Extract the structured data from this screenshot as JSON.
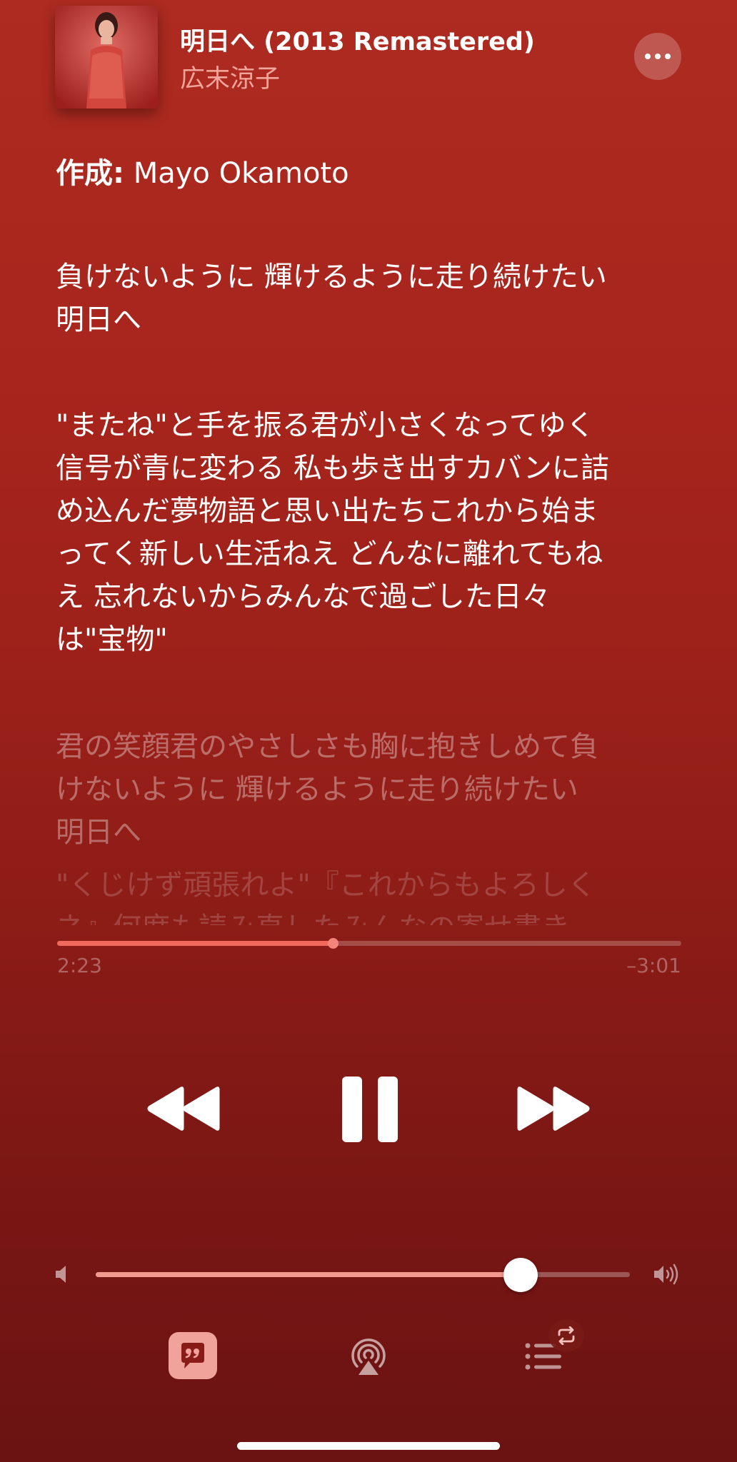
{
  "now_playing": {
    "title": "明日へ (2013 Remastered)",
    "artist": "広末涼子",
    "more_icon": "ellipsis-icon"
  },
  "lyrics": {
    "credit_label": "作成:",
    "credit_value": " Mayo Okamoto",
    "verse_1": [
      "負けないように 輝けるように走り続けたい",
      "明日へ"
    ],
    "verse_2": [
      "\"またね\"と手を振る君が小さくなってゆく",
      "信号が青に変わる 私も歩き出すカバンに詰",
      "め込んだ夢物語と思い出たちこれから始ま",
      "ってく新しい生活ねえ どんなに離れてもね",
      "え 忘れないからみんなで過ごした日々",
      "は\"宝物\""
    ],
    "verse_3": [
      "君の笑顔君のやさしさも胸に抱きしめて負",
      "けないように 輝けるように走り続けたい",
      "明日へ"
    ],
    "verse_4": [
      "\"くじけず頑張れよ\"『これからもよろしく",
      "ネ』何度も読み直したみんなの寄せ書き"
    ]
  },
  "playback": {
    "elapsed": "2:23",
    "remaining": "–3:01",
    "progress": 0.4416
  },
  "transport": {
    "rewind_icon": "rewind-icon",
    "pause_icon": "pause-icon",
    "forward_icon": "fast-forward-icon"
  },
  "volume": {
    "level": 0.795,
    "low_icon": "speaker-low-icon",
    "high_icon": "speaker-high-icon"
  },
  "bottom_bar": {
    "lyrics_icon": "lyrics-quote-icon",
    "airplay_icon": "airplay-icon",
    "queue_icon": "queue-list-icon",
    "repeat_icon": "repeat-icon"
  },
  "colors": {
    "background_top": "#ad2b20",
    "background_bottom": "#6a1312",
    "accent": "#f06a5e",
    "artist_text": "#f2a59b"
  }
}
